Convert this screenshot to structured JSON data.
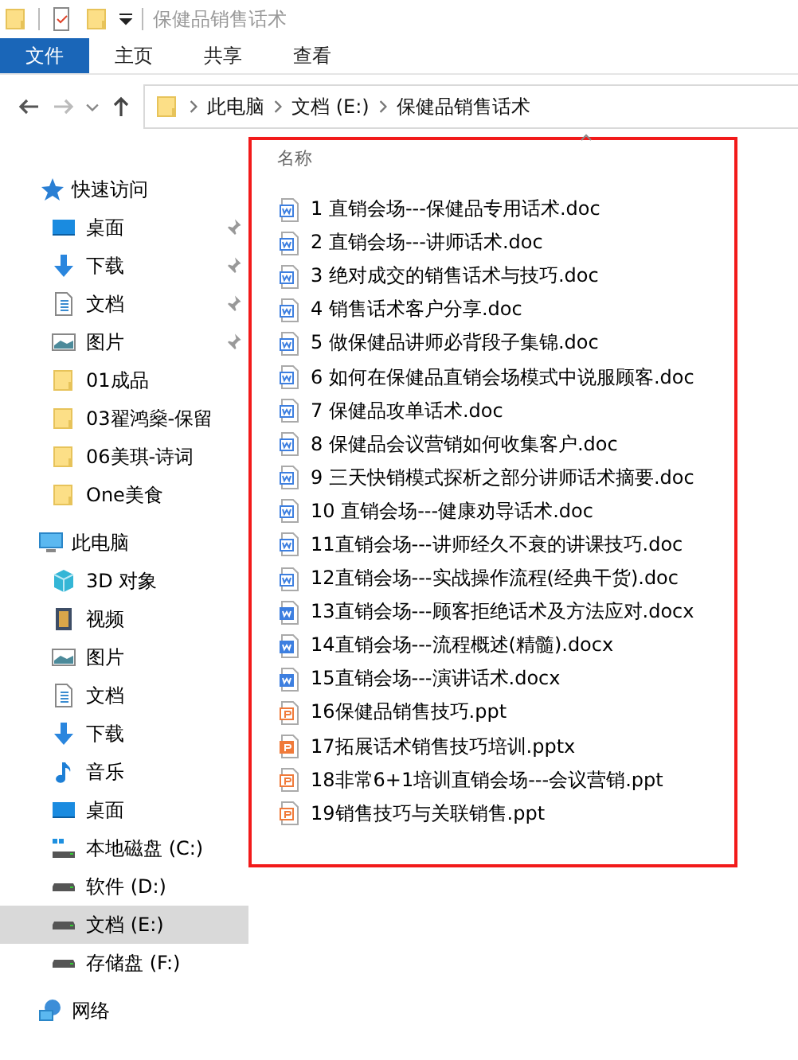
{
  "window": {
    "title": "保健品销售话术"
  },
  "ribbon_tabs": [
    {
      "label": "文件",
      "selected": true
    },
    {
      "label": "主页",
      "selected": false
    },
    {
      "label": "共享",
      "selected": false
    },
    {
      "label": "查看",
      "selected": false
    }
  ],
  "breadcrumb": [
    "此电脑",
    "文档 (E:)",
    "保健品销售话术"
  ],
  "sidebar": {
    "groups": [
      {
        "label": "快速访问",
        "kind": "star",
        "items": [
          {
            "label": "桌面",
            "kind": "desktop",
            "pinned": true,
            "selected": false
          },
          {
            "label": "下载",
            "kind": "download",
            "pinned": true,
            "selected": false
          },
          {
            "label": "文档",
            "kind": "document",
            "pinned": true,
            "selected": false
          },
          {
            "label": "图片",
            "kind": "picture",
            "pinned": true,
            "selected": false
          },
          {
            "label": "01成品",
            "kind": "folder",
            "pinned": false,
            "selected": false
          },
          {
            "label": "03翟鸿燊-保留",
            "kind": "folder",
            "pinned": false,
            "selected": false
          },
          {
            "label": "06美琪-诗词",
            "kind": "folder",
            "pinned": false,
            "selected": false
          },
          {
            "label": "One美食",
            "kind": "folder",
            "pinned": false,
            "selected": false
          }
        ]
      },
      {
        "label": "此电脑",
        "kind": "pc",
        "items": [
          {
            "label": "3D 对象",
            "kind": "cube",
            "pinned": false,
            "selected": false
          },
          {
            "label": "视频",
            "kind": "video",
            "pinned": false,
            "selected": false
          },
          {
            "label": "图片",
            "kind": "picture",
            "pinned": false,
            "selected": false
          },
          {
            "label": "文档",
            "kind": "document",
            "pinned": false,
            "selected": false
          },
          {
            "label": "下载",
            "kind": "download",
            "pinned": false,
            "selected": false
          },
          {
            "label": "音乐",
            "kind": "music",
            "pinned": false,
            "selected": false
          },
          {
            "label": "桌面",
            "kind": "desktop",
            "pinned": false,
            "selected": false
          },
          {
            "label": "本地磁盘 (C:)",
            "kind": "system-drive",
            "pinned": false,
            "selected": false
          },
          {
            "label": "软件 (D:)",
            "kind": "drive",
            "pinned": false,
            "selected": false
          },
          {
            "label": "文档 (E:)",
            "kind": "drive",
            "pinned": false,
            "selected": true
          },
          {
            "label": "存储盘 (F:)",
            "kind": "drive",
            "pinned": false,
            "selected": false
          }
        ]
      },
      {
        "label": "网络",
        "kind": "network"
      }
    ]
  },
  "file_list": {
    "column": "名称",
    "files": [
      {
        "name": "1 直销会场---保健品专用话术.doc",
        "kind": "doc"
      },
      {
        "name": "2 直销会场---讲师话术.doc",
        "kind": "doc"
      },
      {
        "name": "3 绝对成交的销售话术与技巧.doc",
        "kind": "doc"
      },
      {
        "name": "4 销售话术客户分享.doc",
        "kind": "doc"
      },
      {
        "name": "5 做保健品讲师必背段子集锦.doc",
        "kind": "doc"
      },
      {
        "name": "6 如何在保健品直销会场模式中说服顾客.doc",
        "kind": "doc"
      },
      {
        "name": "7 保健品攻单话术.doc",
        "kind": "doc"
      },
      {
        "name": "8 保健品会议营销如何收集客户.doc",
        "kind": "doc"
      },
      {
        "name": "9 三天快销模式探析之部分讲师话术摘要.doc",
        "kind": "doc"
      },
      {
        "name": "10 直销会场---健康劝导话术.doc",
        "kind": "doc"
      },
      {
        "name": "11直销会场---讲师经久不衰的讲课技巧.doc",
        "kind": "doc"
      },
      {
        "name": "12直销会场---实战操作流程(经典干货).doc",
        "kind": "doc"
      },
      {
        "name": "13直销会场---顾客拒绝话术及方法应对.docx",
        "kind": "docx"
      },
      {
        "name": "14直销会场---流程概述(精髓).docx",
        "kind": "docx"
      },
      {
        "name": "15直销会场---演讲话术.docx",
        "kind": "docx"
      },
      {
        "name": "16保健品销售技巧.ppt",
        "kind": "ppt"
      },
      {
        "name": "17拓展话术销售技巧培训.pptx",
        "kind": "pptx"
      },
      {
        "name": "18非常6+1培训直销会场---会议营销.ppt",
        "kind": "ppt"
      },
      {
        "name": "19销售技巧与关联销售.ppt",
        "kind": "ppt"
      }
    ]
  }
}
